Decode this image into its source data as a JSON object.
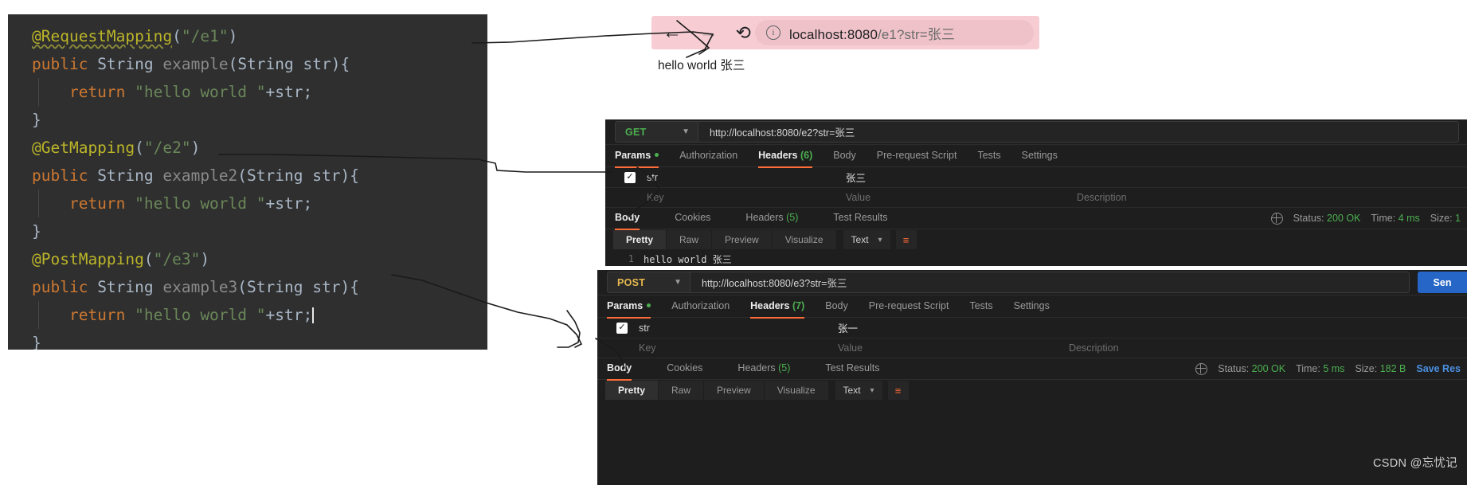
{
  "code_editor": {
    "lines": [
      {
        "id": "l1",
        "indent": false,
        "tokens": [
          {
            "t": "annotation_underlined",
            "v": "@RequestMapping"
          },
          {
            "t": "plain",
            "v": "("
          },
          {
            "t": "string",
            "v": "\"/e1\""
          },
          {
            "t": "plain",
            "v": ")"
          }
        ]
      },
      {
        "id": "l2",
        "indent": false,
        "tokens": [
          {
            "t": "keyword",
            "v": "public "
          },
          {
            "t": "type",
            "v": "String "
          },
          {
            "t": "method",
            "v": "example"
          },
          {
            "t": "plain",
            "v": "("
          },
          {
            "t": "type",
            "v": "String str"
          },
          {
            "t": "plain",
            "v": "){"
          }
        ]
      },
      {
        "id": "l3",
        "indent": true,
        "tokens": [
          {
            "t": "keyword",
            "v": "    return "
          },
          {
            "t": "string",
            "v": "\"hello world \""
          },
          {
            "t": "plain",
            "v": "+str;"
          }
        ]
      },
      {
        "id": "l4",
        "indent": false,
        "tokens": [
          {
            "t": "plain",
            "v": "}"
          }
        ]
      },
      {
        "id": "l5",
        "indent": false,
        "tokens": [
          {
            "t": "annotation",
            "v": "@GetMapping"
          },
          {
            "t": "plain",
            "v": "("
          },
          {
            "t": "string",
            "v": "\"/e2\""
          },
          {
            "t": "plain",
            "v": ")"
          }
        ]
      },
      {
        "id": "l6",
        "indent": false,
        "tokens": [
          {
            "t": "keyword",
            "v": "public "
          },
          {
            "t": "type",
            "v": "String "
          },
          {
            "t": "method",
            "v": "example2"
          },
          {
            "t": "plain",
            "v": "("
          },
          {
            "t": "type",
            "v": "String str"
          },
          {
            "t": "plain",
            "v": "){"
          }
        ]
      },
      {
        "id": "l7",
        "indent": true,
        "tokens": [
          {
            "t": "keyword",
            "v": "    return "
          },
          {
            "t": "string",
            "v": "\"hello world \""
          },
          {
            "t": "plain",
            "v": "+str;"
          }
        ]
      },
      {
        "id": "l8",
        "indent": false,
        "tokens": [
          {
            "t": "plain",
            "v": "}"
          }
        ]
      },
      {
        "id": "l9",
        "indent": false,
        "tokens": [
          {
            "t": "annotation",
            "v": "@PostMapping"
          },
          {
            "t": "plain",
            "v": "("
          },
          {
            "t": "string",
            "v": "\"/e3\""
          },
          {
            "t": "plain",
            "v": ")"
          }
        ]
      },
      {
        "id": "l10",
        "indent": false,
        "tokens": [
          {
            "t": "keyword",
            "v": "public "
          },
          {
            "t": "type",
            "v": "String "
          },
          {
            "t": "method",
            "v": "example3"
          },
          {
            "t": "plain",
            "v": "("
          },
          {
            "t": "type",
            "v": "String str"
          },
          {
            "t": "plain",
            "v": "){"
          }
        ]
      },
      {
        "id": "l11",
        "indent": true,
        "caret": true,
        "tokens": [
          {
            "t": "keyword",
            "v": "    return "
          },
          {
            "t": "string",
            "v": "\"hello world \""
          },
          {
            "t": "plain",
            "v": "+str;"
          }
        ]
      },
      {
        "id": "l12",
        "indent": false,
        "tokens": [
          {
            "t": "plain",
            "v": "}"
          }
        ]
      }
    ],
    "colors": {
      "background": "#2f2f2f",
      "annotation": "#bbb529",
      "keyword": "#cc7832",
      "string": "#6a8759",
      "method": "#8a8a8a",
      "plain": "#a9b7c6"
    }
  },
  "browser": {
    "back_icon": "arrow-left-icon",
    "forward_icon": "arrow-right-icon",
    "reload_icon": "reload-icon",
    "info_icon": "info-circle-icon",
    "url_host": "localhost:8080",
    "url_path": "/e1?str=张三",
    "url_full": "localhost:8080/e1?str=张三",
    "toolbar_color": "#f7cdd3",
    "pill_color": "#eec2c8",
    "page_text": "hello world 张三"
  },
  "postman_get": {
    "method": "GET",
    "method_color": "#4caf50",
    "url": "http://localhost:8080/e2?str=张三",
    "request_tabs": [
      {
        "label": "Params",
        "active": true,
        "dot": true
      },
      {
        "label": "Authorization",
        "active": false
      },
      {
        "label": "Headers",
        "active": true,
        "count": "(6)"
      },
      {
        "label": "Body",
        "active": false
      },
      {
        "label": "Pre-request Script",
        "active": false
      },
      {
        "label": "Tests",
        "active": false
      },
      {
        "label": "Settings",
        "active": false
      }
    ],
    "param_row": {
      "checked": true,
      "key": "str",
      "value": "张三"
    },
    "placeholder_row": {
      "key": "Key",
      "value": "Value",
      "description": "Description"
    },
    "response_tabs": [
      {
        "label": "Body",
        "active": true
      },
      {
        "label": "Cookies",
        "active": false
      },
      {
        "label": "Headers",
        "active": false,
        "count": "(5)"
      },
      {
        "label": "Test Results",
        "active": false
      }
    ],
    "status": {
      "label": "Status:",
      "value": "200 OK",
      "time_label": "Time:",
      "time_value": "4 ms",
      "size_label": "Size:",
      "size_value": "1"
    },
    "view_tabs": [
      {
        "label": "Pretty",
        "active": true
      },
      {
        "label": "Raw",
        "active": false
      },
      {
        "label": "Preview",
        "active": false
      },
      {
        "label": "Visualize",
        "active": false
      }
    ],
    "format_select": "Text",
    "body_line_number": "1",
    "body_text": "hello world 张三"
  },
  "postman_post": {
    "method": "POST",
    "method_color": "#e6b84c",
    "url": "http://localhost:8080/e3?str=张三",
    "send_label": "Sen",
    "request_tabs": [
      {
        "label": "Params",
        "active": true,
        "dot": true
      },
      {
        "label": "Authorization",
        "active": false
      },
      {
        "label": "Headers",
        "active": true,
        "count": "(7)"
      },
      {
        "label": "Body",
        "active": false
      },
      {
        "label": "Pre-request Script",
        "active": false
      },
      {
        "label": "Tests",
        "active": false
      },
      {
        "label": "Settings",
        "active": false
      }
    ],
    "param_row": {
      "checked": true,
      "key": "str",
      "value": "张一"
    },
    "placeholder_row": {
      "key": "Key",
      "value": "Value",
      "description": "Description"
    },
    "response_tabs": [
      {
        "label": "Body",
        "active": true
      },
      {
        "label": "Cookies",
        "active": false
      },
      {
        "label": "Headers",
        "active": false,
        "count": "(5)"
      },
      {
        "label": "Test Results",
        "active": false
      }
    ],
    "status": {
      "label": "Status:",
      "value": "200 OK",
      "time_label": "Time:",
      "time_value": "5 ms",
      "size_label": "Size:",
      "size_value": "182 B",
      "save_response": "Save Res"
    },
    "view_tabs": [
      {
        "label": "Pretty",
        "active": true
      },
      {
        "label": "Raw",
        "active": false
      },
      {
        "label": "Preview",
        "active": false
      },
      {
        "label": "Visualize",
        "active": false
      }
    ],
    "format_select": "Text"
  },
  "watermark": "CSDN @忘忧记"
}
